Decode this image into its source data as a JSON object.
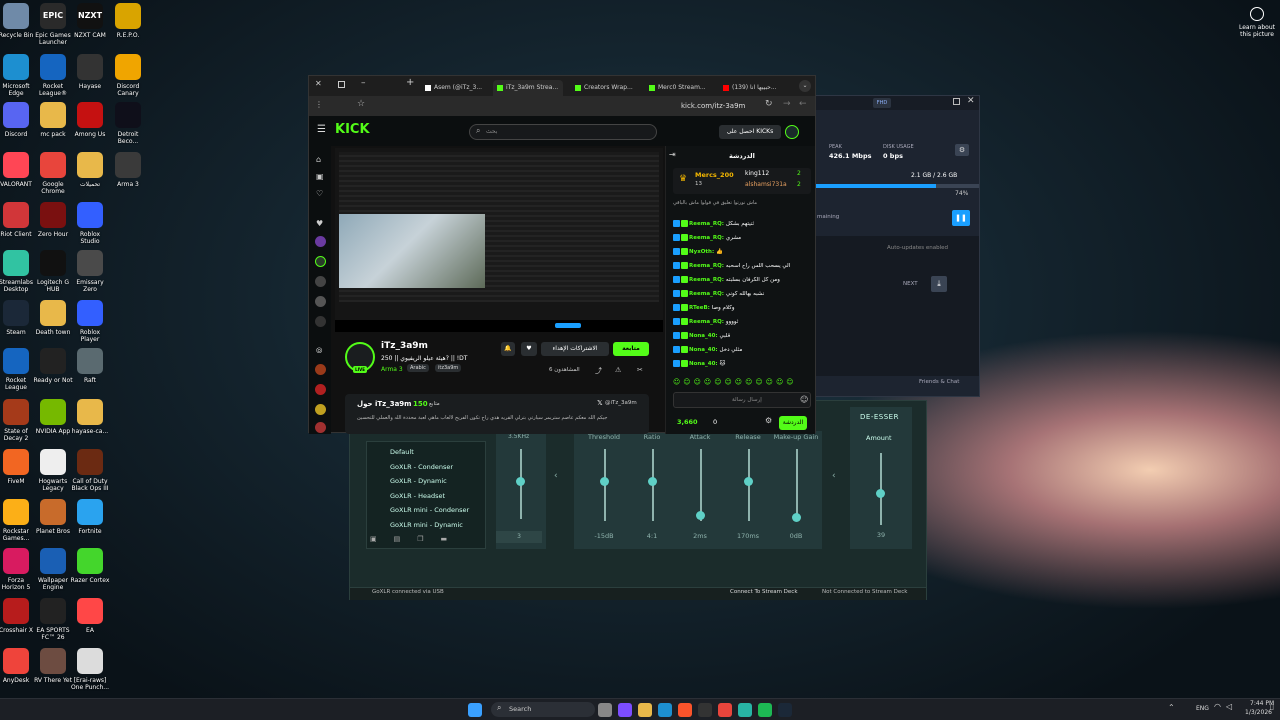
{
  "desktop": {
    "icons": [
      {
        "label": "Recycle Bin",
        "icon": "recycle-bin-icon",
        "color": "#6f8aa8"
      },
      {
        "label": "Epic Games Launcher",
        "icon": "epic-games-icon",
        "color": "#2a2a2a",
        "text": "EPIC"
      },
      {
        "label": "NZXT CAM",
        "icon": "nzxt-icon",
        "color": "#111",
        "text": "NZXT"
      },
      {
        "label": "R.E.P.O.",
        "icon": "repo-icon",
        "color": "#d9a400"
      },
      {
        "label": "Microsoft Edge",
        "icon": "edge-icon",
        "color": "#1d8fd0"
      },
      {
        "label": "Rocket League®",
        "icon": "rocket-league-icon",
        "color": "#1565c0"
      },
      {
        "label": "Hayase",
        "icon": "hayase-icon",
        "color": "#333"
      },
      {
        "label": "Discord Canary",
        "icon": "discord-canary-icon",
        "color": "#f0a500"
      },
      {
        "label": "Discord",
        "icon": "discord-icon",
        "color": "#5865f2"
      },
      {
        "label": "mc pack",
        "icon": "folder-icon",
        "color": "#e8b84a"
      },
      {
        "label": "Among Us",
        "icon": "among-us-icon",
        "color": "#c51111"
      },
      {
        "label": "Detroit Beco...",
        "icon": "detroit-icon",
        "color": "#0f0f1a"
      },
      {
        "label": "VALORANT",
        "icon": "valorant-icon",
        "color": "#ff4655"
      },
      {
        "label": "Google Chrome",
        "icon": "chrome-icon",
        "color": "#e8453c"
      },
      {
        "label": "تحميلات",
        "icon": "folder-icon",
        "color": "#e8b84a"
      },
      {
        "label": "Arma 3",
        "icon": "arma-icon",
        "color": "#3a3a3a"
      },
      {
        "label": "Riot Client",
        "icon": "riot-icon",
        "color": "#d13639"
      },
      {
        "label": "Zero Hour",
        "icon": "zero-hour-icon",
        "color": "#7a1010"
      },
      {
        "label": "Roblox Studio",
        "icon": "roblox-studio-icon",
        "color": "#335fff"
      },
      {
        "label": "Streamlabs Desktop",
        "icon": "streamlabs-icon",
        "color": "#31c3a2"
      },
      {
        "label": "Logitech G HUB",
        "icon": "logitech-icon",
        "color": "#111"
      },
      {
        "label": "Emissary Zero",
        "icon": "emissary-icon",
        "color": "#4a4a4a"
      },
      {
        "label": "Steam",
        "icon": "steam-icon",
        "color": "#1b2838"
      },
      {
        "label": "Death town",
        "icon": "folder-icon",
        "color": "#e8b84a"
      },
      {
        "label": "Roblox Player",
        "icon": "roblox-icon",
        "color": "#335fff"
      },
      {
        "label": "Rocket League",
        "icon": "rocket-league-icon",
        "color": "#1565c0"
      },
      {
        "label": "Ready or Not",
        "icon": "ready-or-not-icon",
        "color": "#222"
      },
      {
        "label": "Raft",
        "icon": "raft-icon",
        "color": "#5a6a70"
      },
      {
        "label": "State of Decay 2",
        "icon": "state-of-decay-icon",
        "color": "#a53a1a"
      },
      {
        "label": "NVIDIA App",
        "icon": "nvidia-icon",
        "color": "#76b900"
      },
      {
        "label": "hayase-ca...",
        "icon": "folder-icon",
        "color": "#e8b84a"
      },
      {
        "label": "FiveM",
        "icon": "fivem-icon",
        "color": "#f26622"
      },
      {
        "label": "Hogwarts Legacy",
        "icon": "document-icon",
        "color": "#eeeeee"
      },
      {
        "label": "Call of Duty Black Ops III",
        "icon": "cod-icon",
        "color": "#6b2a12"
      },
      {
        "label": "Rockstar Games...",
        "icon": "rockstar-icon",
        "color": "#fcaf17"
      },
      {
        "label": "Planet Bros",
        "icon": "planet-icon",
        "color": "#c86b2b"
      },
      {
        "label": "Fortnite",
        "icon": "fortnite-icon",
        "color": "#2aa3ef"
      },
      {
        "label": "Forza Horizon 5",
        "icon": "forza-icon",
        "color": "#d81b60"
      },
      {
        "label": "Wallpaper Engine",
        "icon": "wallpaper-engine-icon",
        "color": "#1a5fb4"
      },
      {
        "label": "Crosshair X",
        "icon": "crosshair-icon",
        "color": "#b71c1c"
      },
      {
        "label": "Razer Cortex",
        "icon": "razer-icon",
        "color": "#44d62c"
      },
      {
        "label": "EA SPORTS FC™ 26",
        "icon": "ea-fc-icon",
        "color": "#222"
      },
      {
        "label": "EA",
        "icon": "ea-icon",
        "color": "#ff4747"
      },
      {
        "label": "AnyDesk",
        "icon": "anydesk-icon",
        "color": "#ef443b"
      },
      {
        "label": "RV There Yet",
        "icon": "rv-icon",
        "color": "#6d4c41"
      },
      {
        "label": "[Erai-raws] One Punch...",
        "icon": "video-file-icon",
        "color": "#dcdcdc"
      }
    ],
    "learn_label": "Learn about this picture"
  },
  "browser": {
    "tabs": [
      "Asem (@iTz_3...",
      "iTz_3a9m Strea...",
      "Creators Wrap...",
      "Merc0 Stream...",
      "(139) حبيبها انا..."
    ],
    "url": "kick.com/itz-3a9m",
    "kick_logo": "KICK",
    "search_placeholder": "بحث",
    "get_kicks": "احصل على KICKs",
    "stream": {
      "username": "iTz_3a9m",
      "title": "هيئة عيلو الريفيوي || 250? || !DT",
      "game": "Arma 3",
      "tags": [
        "Arabic",
        "itz3a9m"
      ],
      "live": "LIVE",
      "viewers": "المشاهدون 6",
      "follow": "متابعة",
      "subscribe": "الاشتراكات الإهداء",
      "time_left": "0:31:26"
    },
    "about": {
      "title": "حول iTz_3a9m",
      "followers": "150",
      "followers_label": "متابع",
      "x_handle": "@iTz_3a9m",
      "bio": "جيكم الله معكم عاصم ستريمر سيارتي بترلي القريه هذي راح تكون الفريج لالعاب ماهي لعبة محددة الله والعملي للتحسين"
    },
    "chat": {
      "title": "الدردشة",
      "top": [
        {
          "name": "Mercs_200",
          "count": "13"
        },
        {
          "name": "king112",
          "count": "2"
        },
        {
          "name": "alshamsi731a",
          "count": "2"
        }
      ],
      "pinned": "ماش نورتوا تعليق في قولوا ماش بالباقي",
      "messages": [
        {
          "user": "Reema_RQ",
          "text": "ثنيتهم بشكل"
        },
        {
          "user": "Reema_RQ",
          "text": "مشري"
        },
        {
          "user": "NyxOth",
          "text": "👍"
        },
        {
          "user": "Reema_RQ",
          "text": "الي يسحب اللس راح اسحبه"
        },
        {
          "user": "Reema_RQ",
          "text": "ومن كل الكرفان بسلبته"
        },
        {
          "user": "Reema_RQ",
          "text": "نشبه بهالله كوني"
        },
        {
          "user": "RTeeB",
          "text": "وكلام وصا"
        },
        {
          "user": "Reema_RQ",
          "text": "ثوووو"
        },
        {
          "user": "Nona_40",
          "text": "قلبي"
        },
        {
          "user": "Nona_40",
          "text": "مثلي دخل"
        },
        {
          "user": "Nona_40",
          "text": "🐱"
        }
      ],
      "input_placeholder": "إرسال رسالة",
      "send": "الدردشة",
      "kicks": "3,660",
      "zero": "0"
    }
  },
  "steam": {
    "peak_label": "PEAK",
    "peak": "426.1 Mbps",
    "disk_label": "DISK USAGE",
    "disk": "0 bps",
    "progress_text": "2.1 GB / 2.6 GB",
    "progress": 0.74,
    "progress_pct": "74%",
    "remaining": "maining",
    "auto_updates": "Auto-updates enabled",
    "next": "NEXT",
    "friends": "Friends & Chat",
    "quality": "FHD"
  },
  "goxlr": {
    "presets": [
      "Default",
      "GoXLR - Condenser",
      "GoXLR - Dynamic",
      "GoXLR - Headset",
      "GoXLR mini - Condenser",
      "GoXLR mini - Dynamic"
    ],
    "section_left": "3.5KHz",
    "left_value": "3",
    "headers": [
      "Threshold",
      "Ratio",
      "Attack",
      "Release",
      "Make-up Gain"
    ],
    "values": [
      "-15dB",
      "4:1",
      "2ms",
      "170ms",
      "0dB"
    ],
    "deesser_title": "DE-ESSER",
    "deesser_amount": "Amount",
    "deesser_value": "39",
    "levels": [
      0.55,
      0.55,
      0.08,
      0.55,
      0.05
    ],
    "deesser_level": 0.45,
    "status": "GoXLR connected via USB",
    "stream_deck": "Connect To Stream Deck",
    "not_connected": "Not Connected to Stream Deck"
  },
  "taskbar": {
    "search": "Search",
    "lang": "ENG",
    "time": "7:44 PM",
    "date": "1/3/2026"
  }
}
